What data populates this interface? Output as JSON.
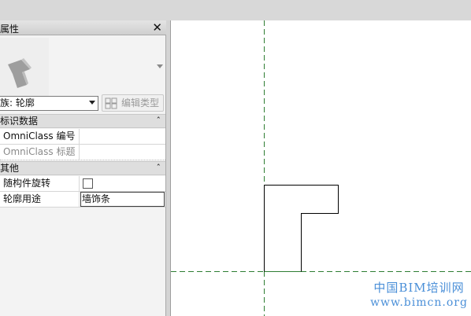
{
  "panel": {
    "title": "属性",
    "close_glyph": "✕",
    "preview_icon": "profile-family-preview-icon",
    "family_selector": {
      "value": "族: 轮廓"
    },
    "edit_type_label": "编辑类型",
    "edit_type_icon": "edit-type-icon",
    "groups": [
      {
        "label": "标识数据",
        "chevron": "ˆ",
        "rows": [
          {
            "label": "OmniClass 编号",
            "value": ""
          },
          {
            "label": "OmniClass 标题",
            "value": ""
          }
        ]
      },
      {
        "label": "其他",
        "chevron": "ˆ",
        "rows": [
          {
            "label": "随构件旋转",
            "value": "",
            "checked": false
          },
          {
            "label": "轮廓用途",
            "value": "墙饰条"
          }
        ]
      }
    ]
  },
  "canvas": {
    "background": "#ffffff",
    "reference_line_color": "#2e7d32",
    "profile_stroke": "#000000"
  },
  "watermark": {
    "title": "中国BIM培训网",
    "url": "www.bimcn.org",
    "color": "#4a8fd8"
  }
}
